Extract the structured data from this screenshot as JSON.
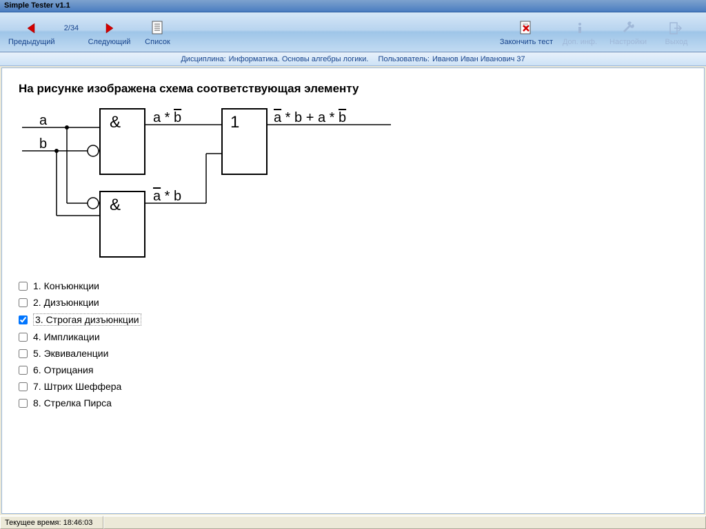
{
  "app_title": "Simple Tester v1.1",
  "toolbar": {
    "prev": "Предыдущий",
    "counter": "2/34",
    "next": "Следующий",
    "list": "Список",
    "finish": "Закончить тест",
    "extra": "Доп. инф.",
    "settings": "Настройки",
    "exit": "Выход"
  },
  "infobar": {
    "discipline_label": "Дисциплина:",
    "discipline": "Информатика. Основы алгебры логики.",
    "user_label": "Пользователь:",
    "user": "Иванов Иван Иванович  37"
  },
  "question": "На рисунке изображена схема соответствующая элементу",
  "diagram": {
    "inputs": {
      "a": "a",
      "b": "b"
    },
    "gate1": "&",
    "gate2": "&",
    "gate3": "1",
    "out1_a": "a * ",
    "out1_b": "b",
    "out2_a": "a",
    "out2_b": " * b",
    "final_a": "a",
    "final_mid": " * b + a * ",
    "final_b": "b"
  },
  "answers": [
    {
      "n": "1.",
      "text": "Конъюнкции",
      "checked": false
    },
    {
      "n": "2.",
      "text": "Дизъюнкции",
      "checked": false
    },
    {
      "n": "3.",
      "text": "Строгая дизъюнкции",
      "checked": true
    },
    {
      "n": "4.",
      "text": "Импликации",
      "checked": false
    },
    {
      "n": "5.",
      "text": "Эквиваленции",
      "checked": false
    },
    {
      "n": "6.",
      "text": "Отрицания",
      "checked": false
    },
    {
      "n": "7.",
      "text": "Штрих Шеффера",
      "checked": false
    },
    {
      "n": "8.",
      "text": "Стрелка Пирса",
      "checked": false
    }
  ],
  "status": {
    "time_label": "Текущее время:",
    "time": "18:46:03"
  }
}
